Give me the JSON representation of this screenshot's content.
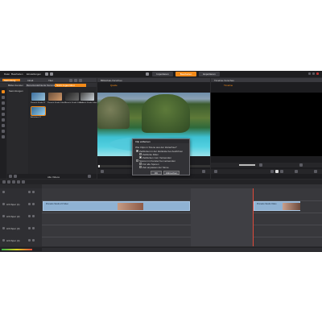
{
  "app": {
    "menu": [
      "Datei",
      "Bearbeiten",
      "Einstellungen"
    ],
    "top_tabs": [
      {
        "label": "Importieren"
      },
      {
        "label": "Bearbeiten"
      },
      {
        "label": "Exportieren"
      }
    ],
    "active_tab": 1
  },
  "library": {
    "header_tabs": [
      "Sammlung",
      "Inhalt",
      "Titel"
    ],
    "source_tabs": [
      "Bilder-Fenster",
      "Benutzerdefinierte Sammlung",
      "Nicht zugeordnet"
    ],
    "tree_label": "Sammlungen",
    "items": [
      {
        "label": "Pinnacle Studio 21"
      },
      {
        "label": "Pinnacle Studio Video 2"
      },
      {
        "label": "Pinnacle Studio Video 3"
      },
      {
        "label": "Pinnacle Studio Video 4"
      },
      {
        "label": "Aufnahme 01"
      }
    ],
    "bottom_label": "Alle Videos"
  },
  "source_player": {
    "title": "Bibliothek-Vorschau",
    "mode": "Quelle"
  },
  "timeline_player": {
    "title": "Timeline-Vorschau",
    "mode": "Timeline"
  },
  "dialog": {
    "title": "Clip entfernen",
    "question": "Wie Clips in Szene aus der Zeitachse?",
    "options": [
      {
        "label": "Zeitlücken in der Zeitleiste bei Ausführen",
        "checked": true
      },
      {
        "label": "Zeitlücke füllen",
        "checked": false
      },
      {
        "label": "Zeitlücken zum Verwenden",
        "checked": true
      },
      {
        "label": "Spuren im Fenster bei verwenden",
        "checked": false
      },
      {
        "label": "Für alle Spuren",
        "checked": false
      },
      {
        "label": "Zeit anpassen der Sinne",
        "checked": false
      }
    ],
    "ok_label": "OK",
    "cancel_label": "Abbrechen"
  },
  "timeline": {
    "tracks": [
      {
        "name": "A/V-Spur (1)"
      },
      {
        "name": "A/V-Spur (2)"
      },
      {
        "name": "A/V-Spur (3)"
      },
      {
        "name": "A/V-Spur (4)"
      }
    ],
    "clips": [
      {
        "label": "Pinnacle Studio 21 Video"
      },
      {
        "label": "Pinnacle Studio Video"
      },
      {
        "label": "Pinnacle Studio 3"
      }
    ]
  },
  "colors": {
    "accent": "#f28a18",
    "clip": "#8fb2d3",
    "panel": "#2b2b2e"
  }
}
